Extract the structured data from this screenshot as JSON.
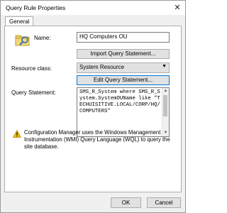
{
  "window": {
    "title": "Query Rule Properties",
    "close_icon": "close-icon"
  },
  "tabs": [
    {
      "label": "General"
    }
  ],
  "form": {
    "name_label": "Name:",
    "name_value": "HQ Computers OU",
    "import_button": "Import Query Statement...",
    "resource_class_label": "Resource class:",
    "resource_class_value": "System Resource",
    "edit_button": "Edit Query Statement...",
    "query_label": "Query Statement:",
    "query_text": "SMS_R_System where SMS_R_System.SystemOUName like \"TECHUISITIVE.LOCAL/CORP/HQ/COMPUTERS\""
  },
  "info": {
    "icon": "warning-icon",
    "text": "Configuration Manager uses the Windows Management Instrumentation (WMI) Query Language (WQL) to query the site database."
  },
  "footer": {
    "ok_label": "OK",
    "cancel_label": "Cancel"
  },
  "colors": {
    "window_bg": "#f0f0f0",
    "focus_border": "#0078d7",
    "warning_yellow": "#f2c200"
  }
}
